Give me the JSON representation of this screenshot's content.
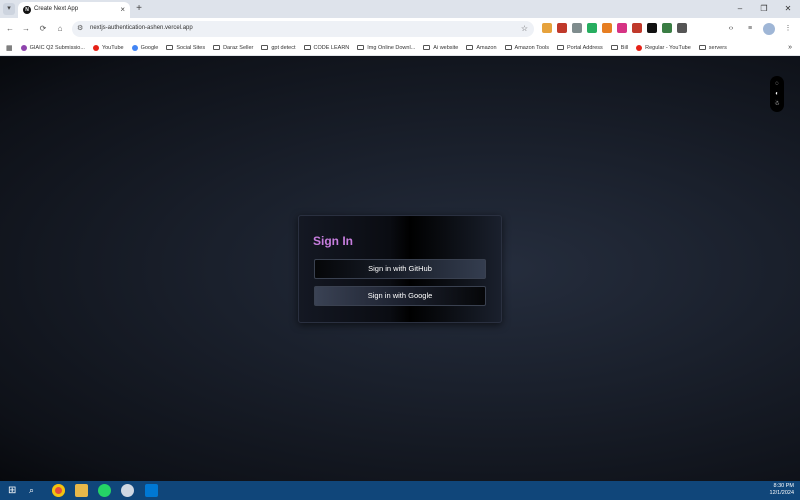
{
  "browser": {
    "tab": {
      "title": "Create Next App",
      "favicon": "nextjs-logo-icon",
      "close": "×"
    },
    "tab_search": "▾",
    "new_tab": "+",
    "window_controls": {
      "minimize": "–",
      "restore": "❐",
      "close": "✕"
    },
    "nav": {
      "back": "←",
      "forward": "→",
      "reload": "⟳",
      "home": "⌂"
    },
    "url": "nextjs-authentication-ashen.vercel.app",
    "site_info": "⚙",
    "star": "☆",
    "toolbar_right": {
      "devtools": "‹›",
      "media": "≡",
      "menu": "⋮"
    }
  },
  "extensions": [
    "#e6a23c",
    "#c0392b",
    "#7f8c8d",
    "#27ae60",
    "#e67e22",
    "#d63384",
    "#c0392b",
    "#111111",
    "#3a7d44",
    "#555555"
  ],
  "bookmarks": [
    {
      "label": "GIAIC Q2 Submissio...",
      "icon": "dot",
      "color": "#8e44ad"
    },
    {
      "label": "YouTube",
      "icon": "dot",
      "color": "#e62117"
    },
    {
      "label": "Google",
      "icon": "google-icon",
      "color": "#4285f4"
    },
    {
      "label": "Social Sites",
      "icon": "folder"
    },
    {
      "label": "Daraz Seller",
      "icon": "folder"
    },
    {
      "label": "gpt detect",
      "icon": "folder"
    },
    {
      "label": "CODE LEARN",
      "icon": "folder"
    },
    {
      "label": "Img Online Downl...",
      "icon": "folder"
    },
    {
      "label": "Ai website",
      "icon": "folder"
    },
    {
      "label": "Amazon",
      "icon": "folder"
    },
    {
      "label": "Amazon Tools",
      "icon": "folder"
    },
    {
      "label": "Portal Address",
      "icon": "folder"
    },
    {
      "label": "Bill",
      "icon": "folder"
    },
    {
      "label": "Regular - YouTube",
      "icon": "dot",
      "color": "#e62117"
    },
    {
      "label": "servers",
      "icon": "folder"
    }
  ],
  "bookmarks_more": "»",
  "page": {
    "card_title": "Sign In",
    "github_button": "Sign in with GitHub",
    "google_button": "Sign in with Google",
    "side_tools": {
      "comment": "◌",
      "toggle": "◐",
      "accessibility": "☃"
    }
  },
  "taskbar": {
    "time": "8:30 PM",
    "date": "12/1/2024"
  },
  "colors": {
    "accent_title": "#c77dde",
    "taskbar": "#10467a"
  }
}
